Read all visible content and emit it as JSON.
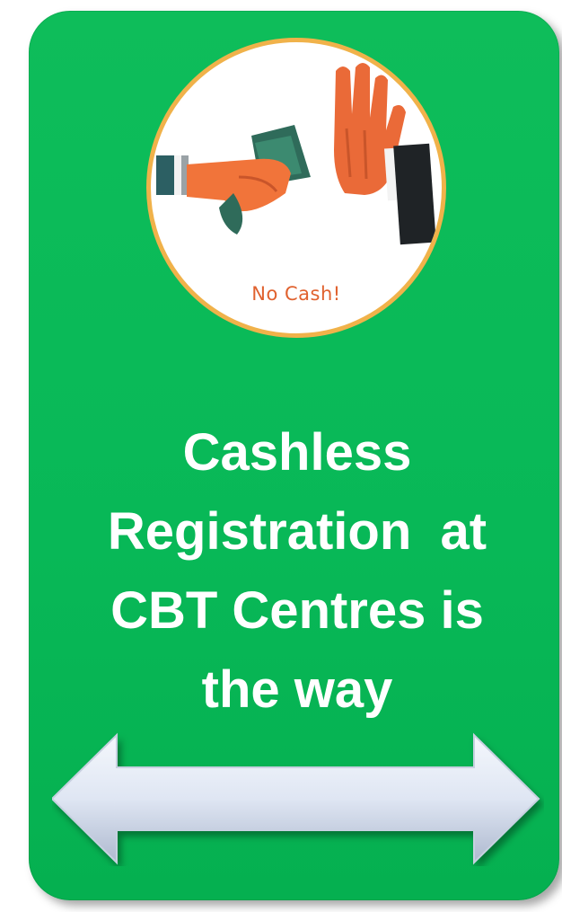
{
  "badge": {
    "caption": "No Cash!",
    "icon": "no-cash-handshake-icon"
  },
  "headline": {
    "lines": [
      "Cashless",
      "Registration  at",
      "CBT Centres is",
      "the way"
    ]
  },
  "arrow": {
    "icon": "double-headed-arrow-icon"
  },
  "colors": {
    "card_green": "#08b857",
    "badge_ring": "#f0b24a",
    "caption_orange": "#e0622f",
    "headline_text": "#ffffff",
    "arrow_fill": "#dfe6f3"
  }
}
